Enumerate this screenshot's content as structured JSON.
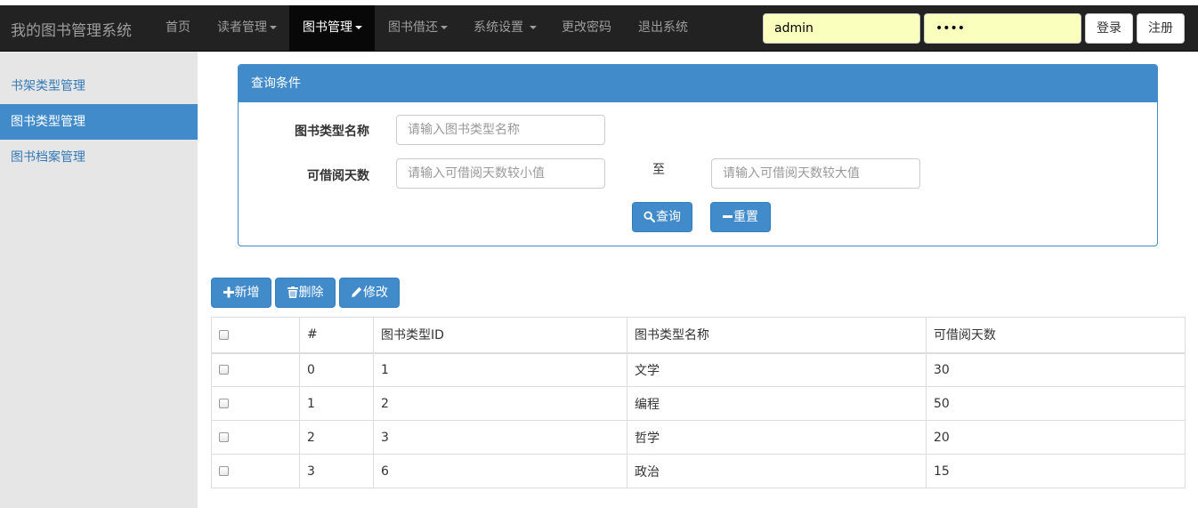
{
  "navbar": {
    "brand": "我的图书管理系统",
    "items": [
      {
        "label": "首页",
        "dropdown": false
      },
      {
        "label": "读者管理",
        "dropdown": true
      },
      {
        "label": "图书管理",
        "dropdown": true,
        "active": true
      },
      {
        "label": "图书借还",
        "dropdown": true
      },
      {
        "label": "系统设置",
        "dropdown": true
      },
      {
        "label": "更改密码",
        "dropdown": false
      },
      {
        "label": "退出系统",
        "dropdown": false
      }
    ],
    "username_value": "admin",
    "password_value": "••••",
    "login_label": "登录",
    "register_label": "注册"
  },
  "sidebar": {
    "items": [
      {
        "label": "书架类型管理"
      },
      {
        "label": "图书类型管理",
        "active": true
      },
      {
        "label": "图书档案管理"
      }
    ]
  },
  "query": {
    "title": "查询条件",
    "type_name_label": "图书类型名称",
    "type_name_placeholder": "请输入图书类型名称",
    "days_label": "可借阅天数",
    "days_min_placeholder": "请输入可借阅天数较小值",
    "to_label": "至",
    "days_max_placeholder": "请输入可借阅天数较大值",
    "search_label": "查询",
    "reset_label": "重置"
  },
  "toolbar": {
    "add_label": "新增",
    "delete_label": "删除",
    "edit_label": "修改"
  },
  "table": {
    "columns": [
      "",
      "#",
      "图书类型ID",
      "图书类型名称",
      "可借阅天数"
    ],
    "rows": [
      [
        "0",
        "1",
        "文学",
        "30"
      ],
      [
        "1",
        "2",
        "编程",
        "50"
      ],
      [
        "2",
        "3",
        "哲学",
        "20"
      ],
      [
        "3",
        "6",
        "政治",
        "15"
      ]
    ]
  },
  "colors": {
    "navbar_bg": "#222222",
    "primary": "#428bca",
    "sidebar_bg": "#e6e6e6",
    "autofill_bg": "#faffbd"
  }
}
